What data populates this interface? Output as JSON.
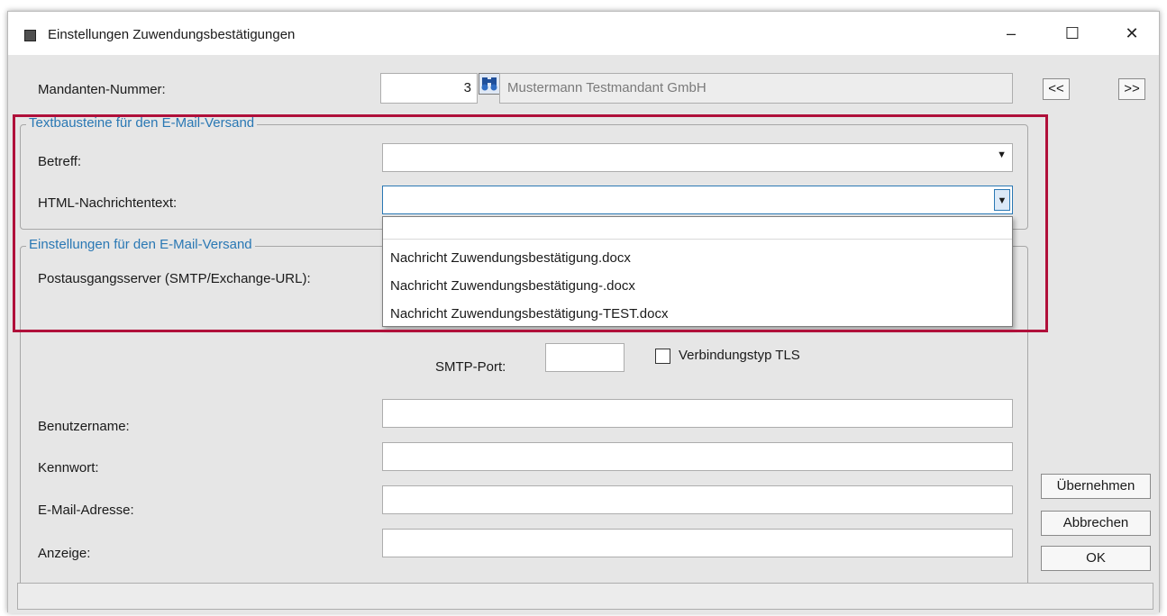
{
  "window": {
    "title": "Einstellungen Zuwendungsbestätigungen",
    "minimize": "–",
    "maximize": "☐",
    "close": "✕"
  },
  "mandant": {
    "label": "Mandanten-Nummer:",
    "number": "3",
    "name": "Mustermann Testmandant GmbH",
    "prev": "<<",
    "next": ">>"
  },
  "textbausteine": {
    "legend": "Textbausteine für den E-Mail-Versand",
    "betreff_label": "Betreff:",
    "betreff_value": "",
    "html_label": "HTML-Nachrichtentext:",
    "html_value": "",
    "options": [
      "",
      "Nachricht Zuwendungsbestätigung.docx",
      "Nachricht Zuwendungsbestätigung-.docx",
      "Nachricht Zuwendungsbestätigung-TEST.docx"
    ]
  },
  "email": {
    "legend": "Einstellungen für den E-Mail-Versand",
    "server_label": "Postausgangsserver (SMTP/Exchange-URL):",
    "port_label": "SMTP-Port:",
    "port_value": "",
    "tls_label": "Verbindungstyp TLS",
    "tls_checked": false,
    "user_label": "Benutzername:",
    "user_value": "",
    "password_label": "Kennwort:",
    "password_value": "",
    "address_label": "E-Mail-Adresse:",
    "address_value": "",
    "display_label": "Anzeige:",
    "display_value": ""
  },
  "buttons": {
    "apply": "Übernehmen",
    "cancel": "Abbrechen",
    "ok": "OK"
  },
  "colors": {
    "highlight": "#b0103a",
    "legend": "#2a78b4"
  },
  "icons": {
    "search": "binoculars-icon",
    "dropdown": "chevron-down-icon"
  }
}
